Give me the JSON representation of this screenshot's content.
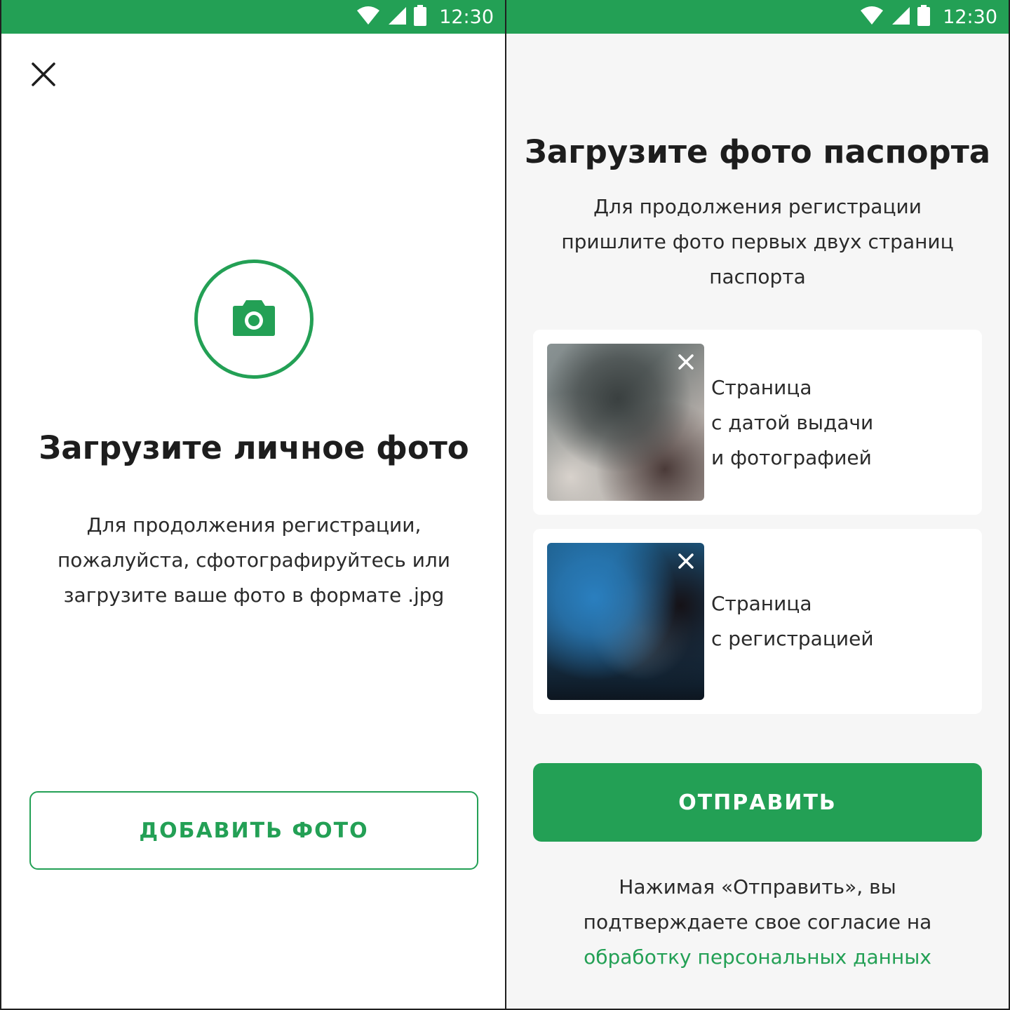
{
  "status_bar": {
    "time": "12:30",
    "icons": [
      "wifi-icon",
      "signal-icon",
      "battery-icon"
    ]
  },
  "colors": {
    "brand_green": "#23a055",
    "background_right": "#f6f6f6",
    "text_dark": "#1d1d1d"
  },
  "left_screen": {
    "close_icon": "close-icon",
    "camera_icon": "camera-icon",
    "title": "Загрузите личное фото",
    "description_lines": [
      "Для продолжения регистрации,",
      "пожалуйста, сфотографируйтесь или",
      "загрузите ваше фото в формате .jpg"
    ],
    "add_photo_button": "ДОБАВИТЬ ФОТО"
  },
  "right_screen": {
    "title": "Загрузите фото паспорта",
    "description_lines": [
      "Для продолжения регистрации",
      "пришлите фото первых двух страниц",
      "паспорта"
    ],
    "documents": [
      {
        "label_lines": [
          "Страница",
          "с датой выдачи",
          "и фотографией"
        ],
        "remove_icon": "close-icon"
      },
      {
        "label_lines": [
          "Страница",
          "с регистрацией"
        ],
        "remove_icon": "close-icon"
      }
    ],
    "send_button": "ОТПРАВИТЬ",
    "consent_lines": [
      "Нажимая «Отправить», вы",
      "подтверждаете свое согласие на"
    ],
    "consent_link": "обработку персональных данных"
  }
}
